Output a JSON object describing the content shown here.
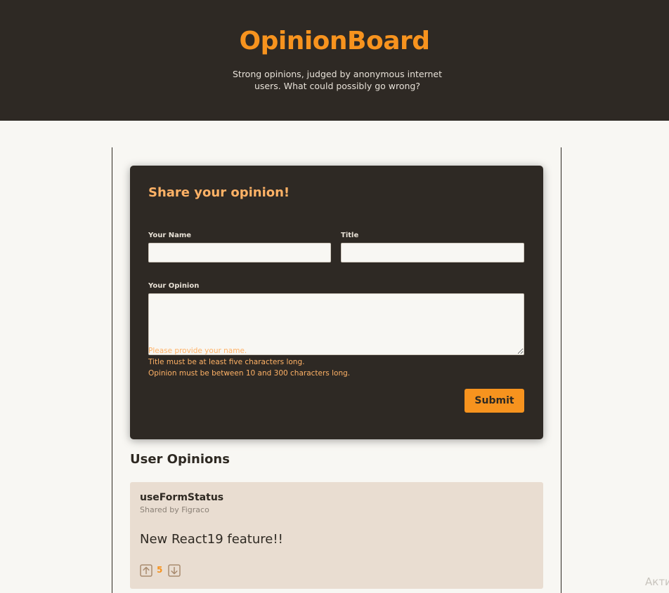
{
  "header": {
    "title": "OpinionBoard",
    "tagline": "Strong opinions, judged by anonymous internet users. What could possibly go wrong?"
  },
  "form": {
    "heading": "Share your opinion!",
    "name_label": "Your Name",
    "name_value": "",
    "title_label": "Title",
    "title_value": "",
    "opinion_label": "Your Opinion",
    "opinion_value": "",
    "errors": [
      "Please provide your name.",
      "Title must be at least five characters long.",
      "Opinion must be between 10 and 300 characters long."
    ],
    "submit_label": "Submit"
  },
  "opinions": {
    "heading": "User Opinions",
    "items": [
      {
        "title": "useFormStatus",
        "author": "Shared by Figraco",
        "body": "New React19 feature!!",
        "votes": "5",
        "upvote_icon": "arrow-up-icon",
        "downvote_icon": "arrow-down-icon"
      }
    ]
  },
  "watermark": "Акти",
  "colors": {
    "header_bg": "#2e2924",
    "accent": "#f7931e",
    "form_heading": "#ffb266",
    "page_bg": "#f8f7f3",
    "card_bg": "#e9ddd1"
  }
}
